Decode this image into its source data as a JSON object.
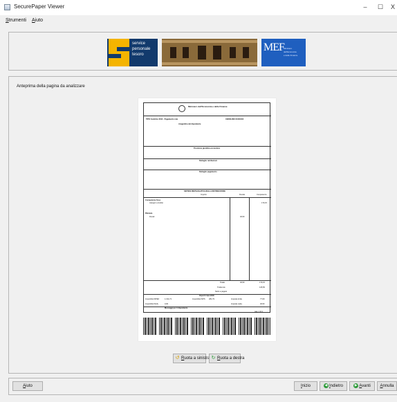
{
  "window": {
    "title": "SecurePaper Viewer",
    "controls": {
      "minimize": "–",
      "maximize": "☐",
      "close": "X"
    }
  },
  "menu": {
    "items": [
      {
        "label_underlined": "S",
        "label_rest": "trumenti"
      },
      {
        "label_underlined": "A",
        "label_rest": "iuto"
      }
    ]
  },
  "banner": {
    "logo_left_lines": [
      "service",
      "personale",
      "tesoro"
    ],
    "logo_right_title": "MEF",
    "logo_right_sub": [
      "Ministero",
      "dell'Economia",
      "e delle Finanze"
    ]
  },
  "preview": {
    "label": "Anteprima della pagina da analizzare",
    "document": {
      "header": "Ministero dell'Economia e delle Finanze",
      "row1_left": "TIPO Cedolino  2014 - Pagamento rate",
      "row1_right": "CEDOLINO  XX/XX/XX",
      "section1": "Anagrafica del dipendente",
      "section2": "Posizione giuridica economica",
      "section3": "Dettaglio retribuzioni",
      "section4": "Dettaglio pagamento",
      "section5": "SINTESI RIEPILOGATIVA DELLA RETRIBUZIONE",
      "col_importo": "Importo",
      "col_fiscale": "Fiscale",
      "col_competenze": "Competenze",
      "col_ritenute": "Ritenute",
      "row_comp": "Competenze fisse",
      "row_comp_sub": "Assegni a credito",
      "row_rit": "Ritenute",
      "row_rit_sub": "Fiscali",
      "val_comp": "173,15",
      "val_rit": "46,53",
      "tot_label": "Totale",
      "tot_fiscale": "46,53",
      "tot_comp": "173,15",
      "row_trattenute": "Trattenute",
      "val_trattenute": "126,56",
      "row_netto": "Netto a pagare",
      "section6": "Importi imponibili",
      "imp1_label": "Imponibile IRPEF",
      "imp1": "1.314,71",
      "imp2_label": "Imponibile INPS",
      "imp2": "281,79",
      "imp3_label": "Imponibile INAIL",
      "imp3": "0,00",
      "imp4_label": "Imposta lorda",
      "imp4": "77,09",
      "imp5_label": "Imposta netta",
      "imp5": "46,53",
      "footer_line": "Messaggi per il dipendente",
      "page_num": "pag. 1 di 1"
    }
  },
  "rotate_left": {
    "underlined": "R",
    "rest": "uota a sinistra",
    "icon": "rotate-left-icon"
  },
  "rotate_right": {
    "underlined": "R",
    "rest": "uota a destra",
    "icon": "rotate-right-icon"
  },
  "footer": {
    "help": {
      "underlined": "A",
      "rest": "iuto"
    },
    "start": {
      "underlined": "I",
      "rest": "nizio"
    },
    "back": {
      "underlined": "I",
      "rest": "ndietro"
    },
    "next": {
      "underlined": "A",
      "rest": "vanti"
    },
    "cancel": {
      "underlined": "A",
      "rest": "nnulla"
    }
  },
  "colors": {
    "accent_green": "#2e9b3a",
    "spt_blue": "#123a6c",
    "spt_yellow": "#f4b400",
    "mef_blue": "#1f5fbf"
  }
}
